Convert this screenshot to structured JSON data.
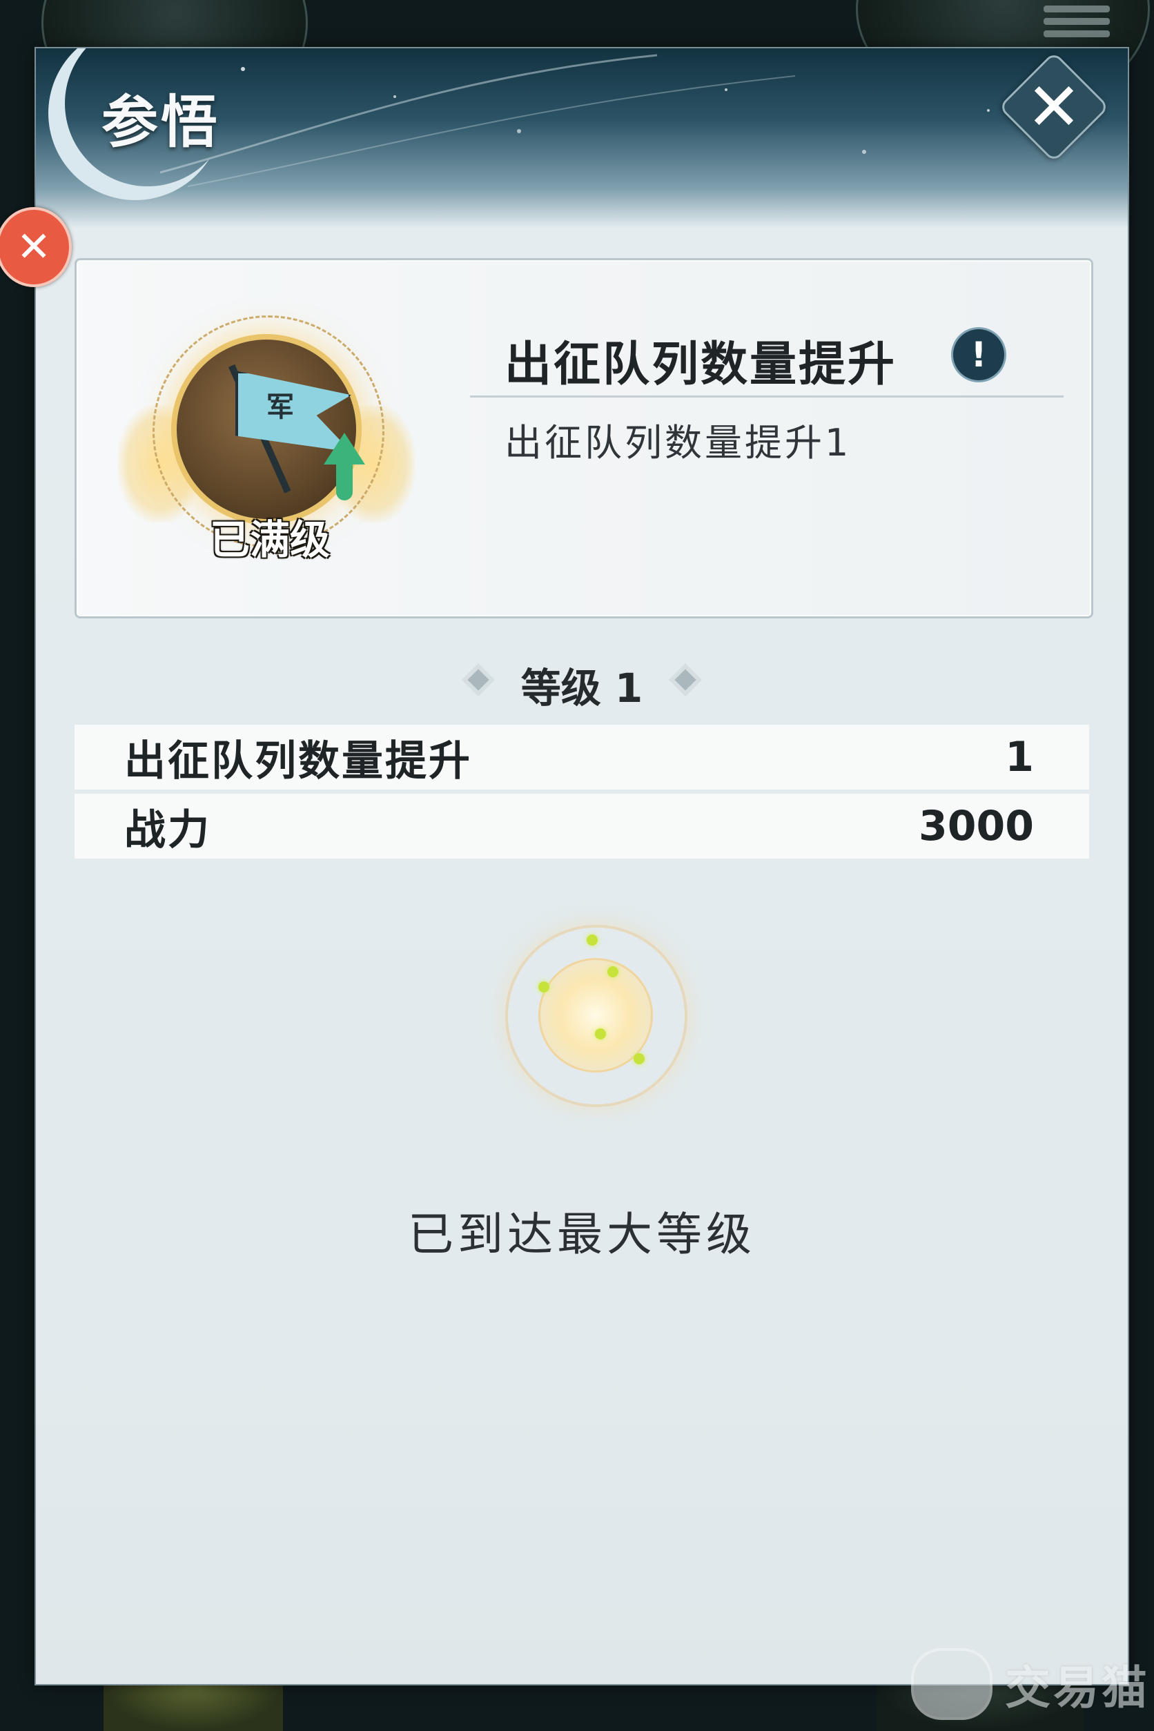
{
  "dialog": {
    "title": "参悟",
    "close_icon": "close-icon"
  },
  "side_badge": {
    "glyph": "✕",
    "icon": "side-badge-icon"
  },
  "skill": {
    "icon": "flag-upgrade-icon",
    "flag_char": "军",
    "status_label": "已满级",
    "name": "出征队列数量提升",
    "info_icon": "info-icon",
    "info_glyph": "!",
    "description": "出征队列数量提升1"
  },
  "level": {
    "label": "等级 1"
  },
  "stats": [
    {
      "label": "出征队列数量提升",
      "value": "1"
    },
    {
      "label": "战力",
      "value": "3000"
    }
  ],
  "max_message": "已到达最大等级",
  "watermark": {
    "text": "交易猫"
  },
  "colors": {
    "panel_bg": "#e3ebee",
    "header_dark": "#123240",
    "gold_accent": "#e9c46a",
    "info_blue": "#1d3c4c",
    "badge_red": "#e95a42"
  }
}
